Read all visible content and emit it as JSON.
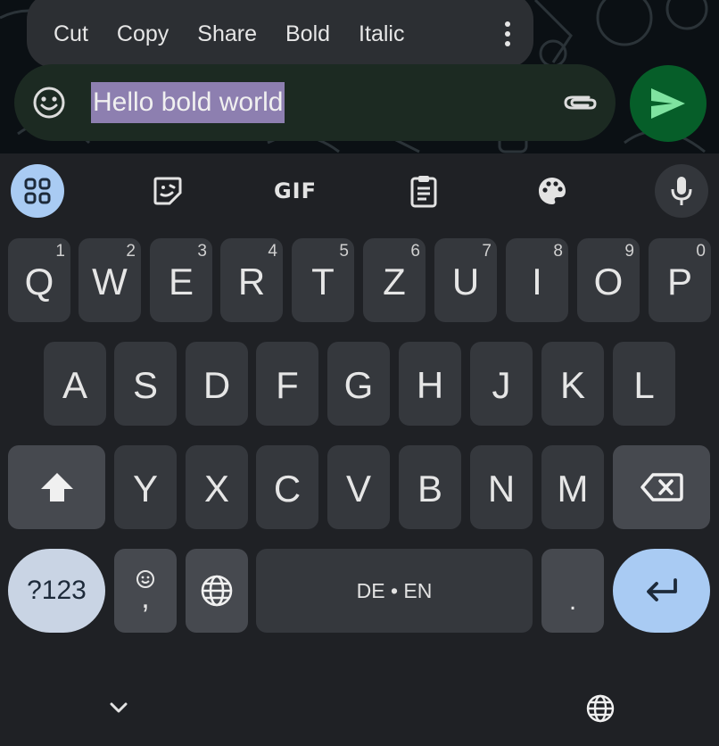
{
  "context_menu": {
    "items": [
      "Cut",
      "Copy",
      "Share",
      "Bold",
      "Italic"
    ],
    "more_icon": "more-vert-icon"
  },
  "input": {
    "selected_text": "Hello bold world",
    "emoji_icon": "emoji-icon",
    "attach_icon": "paperclip-icon",
    "selection_color": "#8d7fb0"
  },
  "send": {
    "icon": "send-icon",
    "color": "#065e29"
  },
  "toolbar": {
    "gif_label": "GIF",
    "icons": [
      "apps-grid-icon",
      "sticker-icon",
      "gif-icon",
      "clipboard-icon",
      "palette-icon",
      "mic-icon"
    ]
  },
  "keyboard": {
    "row1": [
      {
        "key": "Q",
        "hint": "1"
      },
      {
        "key": "W",
        "hint": "2"
      },
      {
        "key": "E",
        "hint": "3"
      },
      {
        "key": "R",
        "hint": "4"
      },
      {
        "key": "T",
        "hint": "5"
      },
      {
        "key": "Z",
        "hint": "6"
      },
      {
        "key": "U",
        "hint": "7"
      },
      {
        "key": "I",
        "hint": "8"
      },
      {
        "key": "O",
        "hint": "9"
      },
      {
        "key": "P",
        "hint": "0"
      }
    ],
    "row2": [
      "A",
      "S",
      "D",
      "F",
      "G",
      "H",
      "J",
      "K",
      "L"
    ],
    "row3": [
      "Y",
      "X",
      "C",
      "V",
      "B",
      "N",
      "M"
    ],
    "symbols_label": "?123",
    "comma_label": ",",
    "period_label": ".",
    "space_label": "DE • EN",
    "accent_color": "#a9cbf3"
  },
  "nav": {
    "hide_icon": "chevron-down-icon",
    "language_icon": "globe-icon"
  }
}
